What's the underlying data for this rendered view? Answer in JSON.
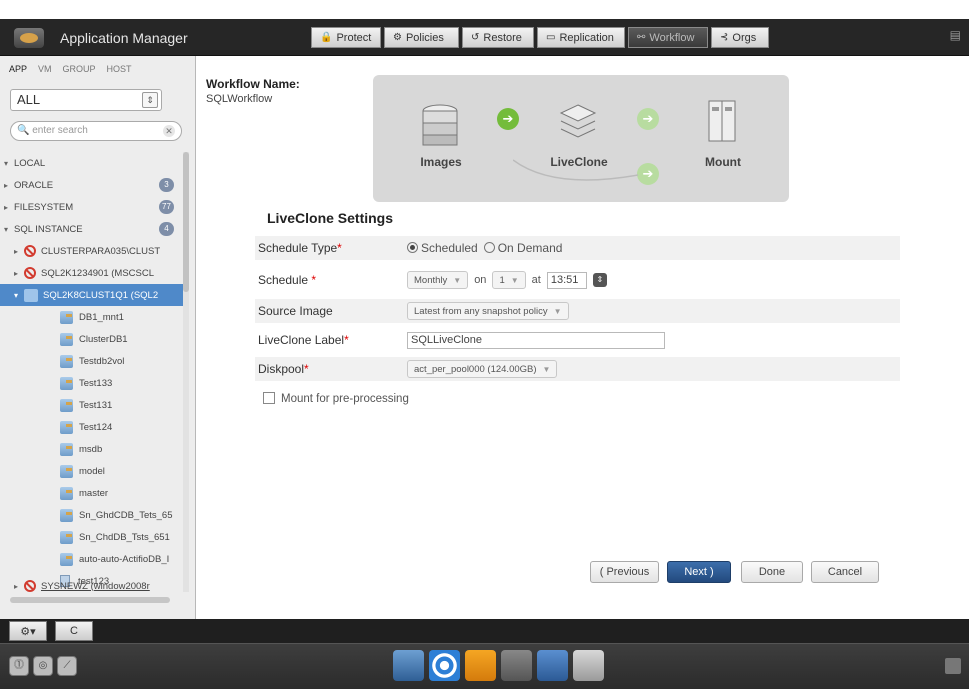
{
  "app": {
    "title": "Application Manager"
  },
  "nav": {
    "tabs": [
      {
        "label": "Protect",
        "icon": "lock-icon"
      },
      {
        "label": "Policies",
        "icon": "gear-icon"
      },
      {
        "label": "Restore",
        "icon": "restore-icon"
      },
      {
        "label": "Replication",
        "icon": "replication-icon"
      },
      {
        "label": "Workflow",
        "icon": "workflow-icon"
      },
      {
        "label": "Orgs",
        "icon": "orgs-icon"
      }
    ],
    "active": "Workflow"
  },
  "sidebar": {
    "tabs": [
      "APP",
      "VM",
      "GROUP",
      "HOST"
    ],
    "active_tab": "APP",
    "filter_value": "ALL",
    "search_placeholder": "enter search",
    "tree": [
      {
        "label": "LOCAL"
      },
      {
        "label": "ORACLE",
        "count": "3"
      },
      {
        "label": "FILESYSTEM",
        "count": "77"
      },
      {
        "label": "SQL INSTANCE",
        "count": "4"
      },
      {
        "label": "CLUSTERPARA035\\CLUST"
      },
      {
        "label": "SQL2K1234901 (MSCSCL"
      },
      {
        "label": "SQL2K8CLUST1Q1 (SQL2"
      },
      {
        "label": "DB1_mnt1"
      },
      {
        "label": "ClusterDB1"
      },
      {
        "label": "Testdb2vol"
      },
      {
        "label": "Test133"
      },
      {
        "label": "Test131"
      },
      {
        "label": "Test124"
      },
      {
        "label": "msdb"
      },
      {
        "label": "model"
      },
      {
        "label": "master"
      },
      {
        "label": "Sn_GhdCDB_Tets_65"
      },
      {
        "label": "Sn_ChdDB_Tsts_651"
      },
      {
        "label": "auto-auto-ActifioDB_I"
      },
      {
        "label": "test123"
      },
      {
        "label": "SYSNEWZ (window2008r"
      }
    ]
  },
  "workflow": {
    "name_label": "Workflow Name:",
    "name_value": "SQLWorkflow",
    "steps": [
      "Images",
      "LiveClone",
      "Mount"
    ]
  },
  "settings": {
    "title": "LiveClone Settings",
    "schedule_type": {
      "label": "Schedule Type",
      "options": [
        "Scheduled",
        "On Demand"
      ],
      "selected": "Scheduled"
    },
    "schedule": {
      "label": "Schedule ",
      "frequency": "Monthly",
      "on_label": "on",
      "day": "1",
      "at_label": "at",
      "time": "13:51"
    },
    "source_image": {
      "label": "Source Image",
      "value": "Latest from any snapshot policy"
    },
    "liveclone_label": {
      "label": "LiveClone Label",
      "value": "SQLLiveClone"
    },
    "diskpool": {
      "label": "Diskpool",
      "value": "act_per_pool000 (124.00GB)"
    },
    "mount_checkbox": {
      "label": "Mount for pre-processing",
      "checked": false
    }
  },
  "buttons": {
    "previous": "( Previous",
    "next": "Next )",
    "done": "Done",
    "cancel": "Cancel"
  },
  "bottom": {
    "tool_buttons": [
      "⚙▾",
      "C"
    ]
  },
  "colors": {
    "accent": "#4f89c9",
    "primary_button": "#2d5a92",
    "required": "#dd0000",
    "arrow_green": "#74bc3b"
  }
}
